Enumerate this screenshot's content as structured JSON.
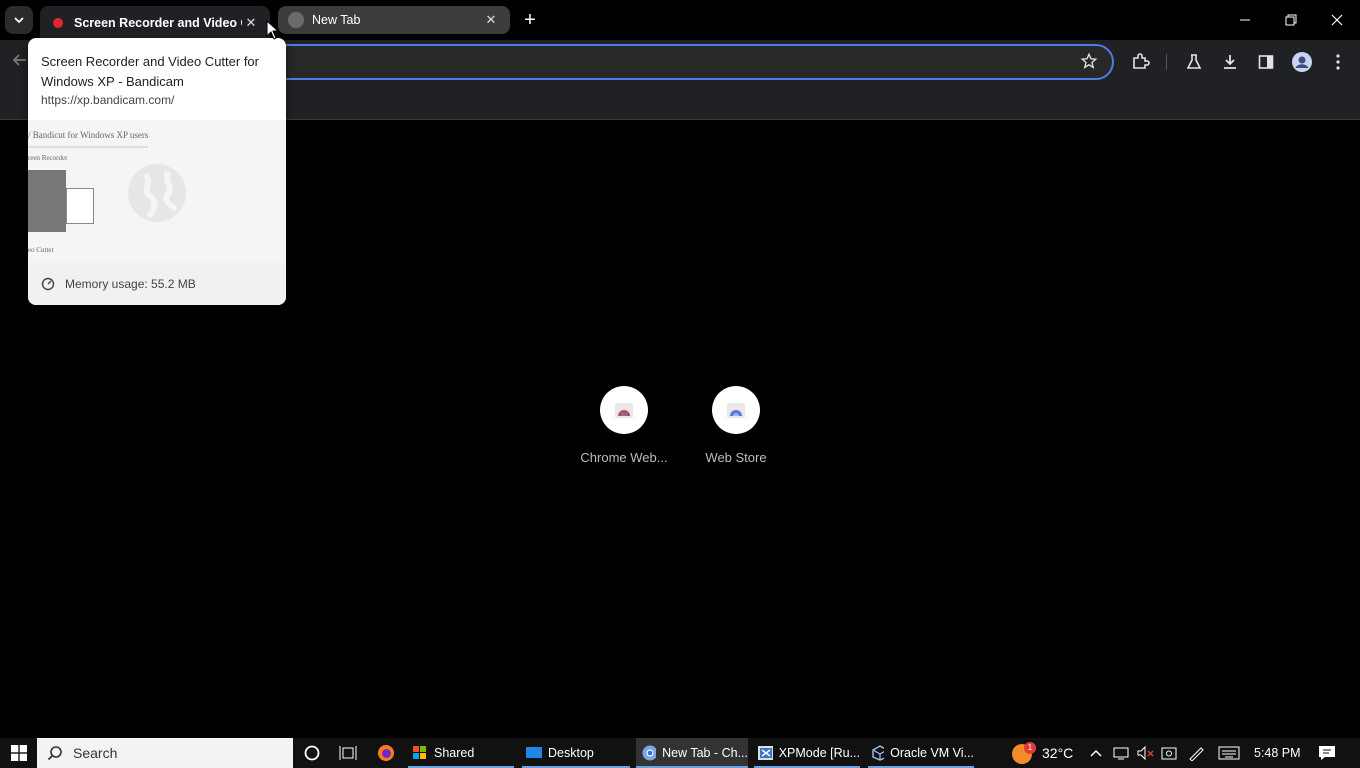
{
  "tabs": [
    {
      "title": "Screen Recorder and Video Cutter for Windows XP - Bandicam",
      "active": true
    },
    {
      "title": "New Tab",
      "active": false
    }
  ],
  "hovercard": {
    "title": "Screen Recorder and Video Cutter for Windows XP - Bandicam",
    "url": "https://xp.bandicam.com/",
    "memory": "Memory usage: 55.2 MB",
    "preview_heading": "/ Bandicut for Windows XP users",
    "preview_sub1": "reen Recorder",
    "preview_sub2": "eo Cutter"
  },
  "shortcuts": [
    {
      "label": "Chrome Web..."
    },
    {
      "label": "Web Store"
    }
  ],
  "taskbar": {
    "search_placeholder": "Search",
    "items": [
      {
        "label": "Shared"
      },
      {
        "label": "Desktop"
      },
      {
        "label": "New Tab - Ch..."
      },
      {
        "label": "XPMode [Ru..."
      },
      {
        "label": "Oracle VM Vi..."
      }
    ],
    "weather": "32°C",
    "weather_badge": "1",
    "time": "5:48 PM"
  },
  "colors": {
    "accent": "#4d7ce8",
    "bandicam_red": "#e3262e"
  }
}
